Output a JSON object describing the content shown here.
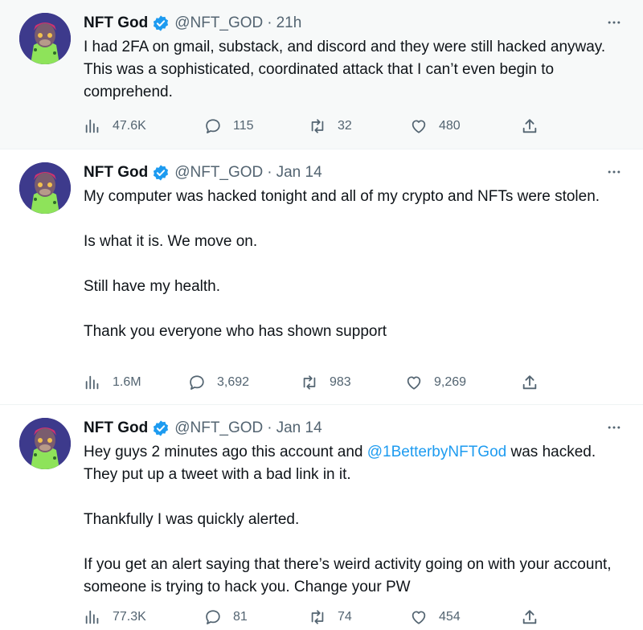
{
  "tweets": [
    {
      "name": "NFT God",
      "handle": "@NFT_GOD",
      "separator": "·",
      "time": "21h",
      "paragraphs": [
        "I had 2FA on gmail, substack, and discord and they were still hacked anyway. This was a sophisticated, coordinated attack that I can’t even begin to comprehend."
      ],
      "stats": {
        "views": "47.6K",
        "replies": "115",
        "retweets": "32",
        "likes": "480"
      }
    },
    {
      "name": "NFT God",
      "handle": "@NFT_GOD",
      "separator": "·",
      "time": "Jan 14",
      "paragraphs": [
        "My computer was hacked tonight and all of my crypto and NFTs were stolen.",
        "Is what it is. We move on.",
        "Still have my health.",
        "Thank you everyone who has shown support"
      ],
      "stats": {
        "views": "1.6M",
        "replies": "3,692",
        "retweets": "983",
        "likes": "9,269"
      }
    },
    {
      "name": "NFT God",
      "handle": "@NFT_GOD",
      "separator": "·",
      "time": "Jan 14",
      "text_intro": "Hey guys 2 minutes ago this account and ",
      "mention": "@1BetterbyNFTGod",
      "text_after_mention": " was hacked. They put up a tweet with a bad link in it.",
      "paragraphs": [
        "Thankfully I was quickly alerted.",
        "If you get an alert saying that there’s weird activity going on with your account, someone is trying to hack you. Change your PW"
      ],
      "stats": {
        "views": "77.3K",
        "replies": "81",
        "retweets": "74",
        "likes": "454"
      }
    }
  ],
  "icons": {
    "views": "views-icon",
    "reply": "reply-icon",
    "retweet": "retweet-icon",
    "like": "like-icon",
    "share": "share-icon",
    "more": "more-icon",
    "verified": "verified-badge-icon"
  },
  "colors": {
    "text": "#0f1419",
    "secondary": "#536471",
    "link": "#1d9bf0",
    "verified": "#1d9bf0",
    "highlight_bg": "#f7f9f9",
    "avatar_bg": "#3d3a8c"
  }
}
